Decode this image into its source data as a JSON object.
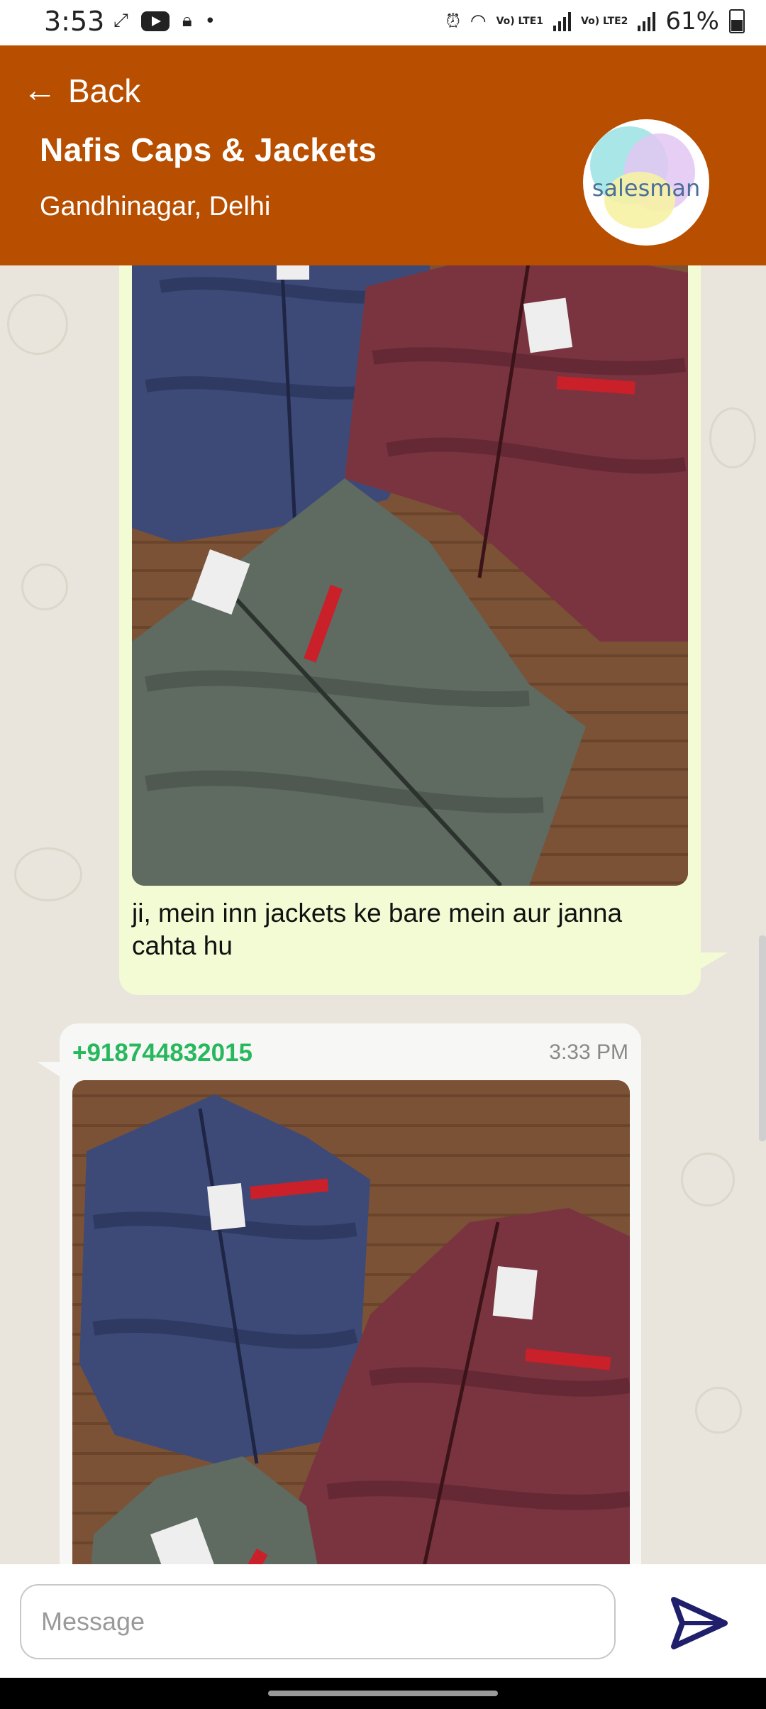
{
  "status_bar": {
    "time": "3:53",
    "network1": "Vo) LTE1",
    "network2": "Vo) LTE2",
    "battery": "61%"
  },
  "header": {
    "back_label": "Back",
    "shop_name": "Nafis Caps & Jackets",
    "location": "Gandhinagar, Delhi",
    "avatar_text": "salesman",
    "bg_color": "#b84e00"
  },
  "messages": [
    {
      "direction": "outgoing",
      "image": "jackets-photo",
      "text": "ji, mein inn jackets ke bare mein aur janna cahta hu"
    },
    {
      "direction": "incoming",
      "sender": "+918744832015",
      "time": "3:33 PM",
      "image": "jackets-photo"
    }
  ],
  "composer": {
    "placeholder": "Message",
    "send_icon": "send-icon"
  }
}
